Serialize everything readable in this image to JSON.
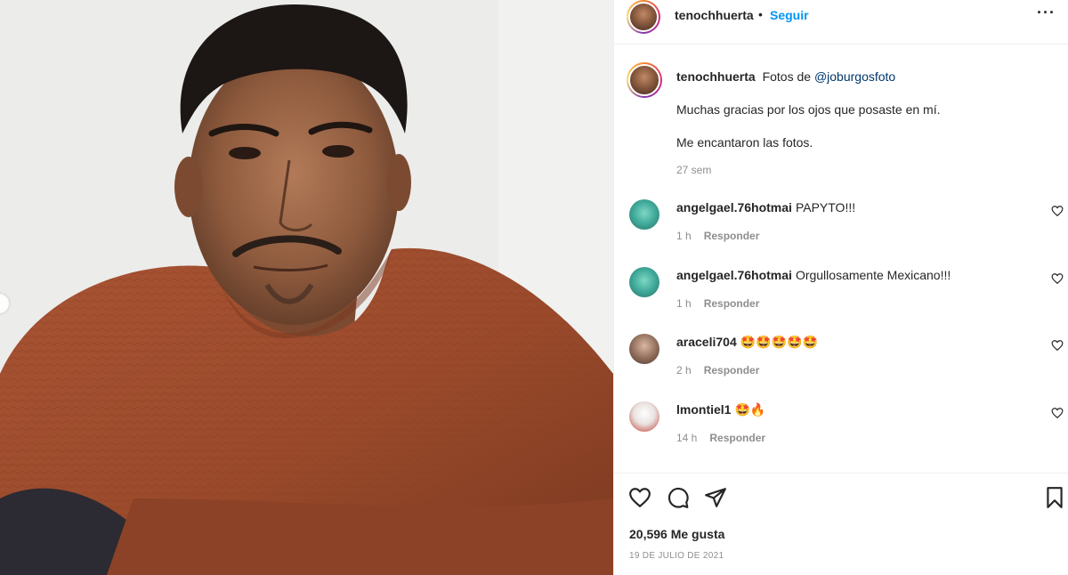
{
  "post": {
    "author": "tenochhuerta",
    "separator": "•",
    "follow_label": "Seguir",
    "more_label": "···"
  },
  "caption": {
    "author": "tenochhuerta",
    "line1_prefix": "Fotos de",
    "mention": "@joburgosfoto",
    "line2": "Muchas gracias por los ojos que posaste en mí.",
    "line3": "Me encantaron las fotos.",
    "time": "27 sem"
  },
  "comments": [
    {
      "user": "angelgael.76hotmai",
      "text": "PAPYTO!!!",
      "time": "1 h",
      "reply": "Responder"
    },
    {
      "user": "angelgael.76hotmai",
      "text": "Orgullosamente Mexicano!!!",
      "time": "1 h",
      "reply": "Responder"
    },
    {
      "user": "araceli704",
      "text": "🤩🤩🤩🤩🤩",
      "time": "2 h",
      "reply": "Responder"
    },
    {
      "user": "lmontiel1",
      "text": "🤩🔥",
      "time": "14 h",
      "reply": "Responder"
    }
  ],
  "footer": {
    "likes": "20,596 Me gusta",
    "date": "19 DE JULIO DE 2021"
  },
  "icons": {
    "like": "heart-icon",
    "comment": "comment-icon",
    "share": "paper-plane-icon",
    "save": "bookmark-icon",
    "comment_like": "small-heart-icon"
  },
  "colors": {
    "accent": "#0095f6",
    "mention": "#00376b",
    "muted": "#8e8e8e",
    "sweater": "#9b4a2a"
  }
}
